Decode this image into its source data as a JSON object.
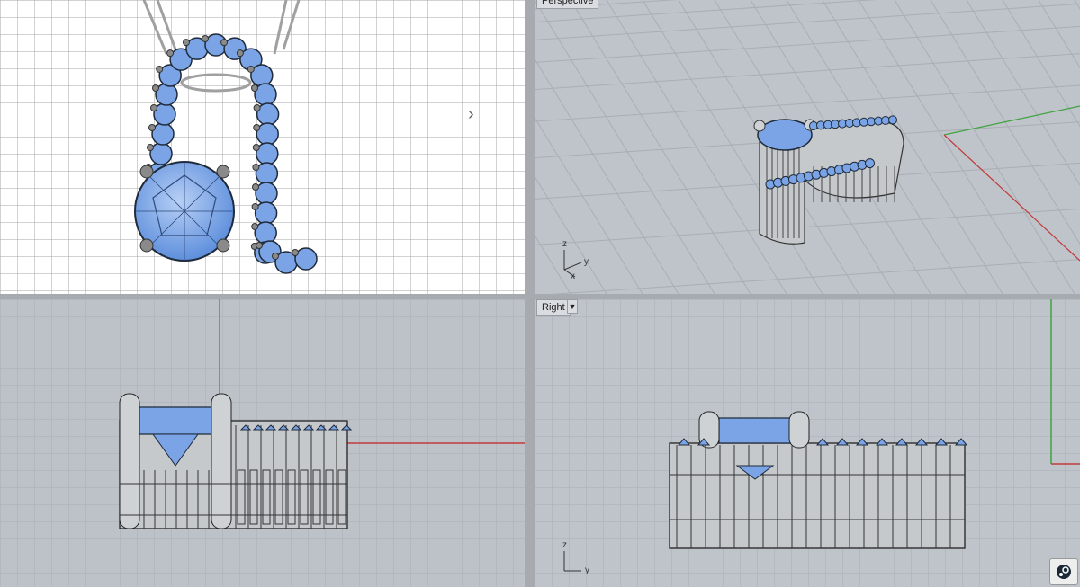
{
  "viewports": {
    "top": {
      "label": ""
    },
    "perspective": {
      "label": "Perspective"
    },
    "front": {
      "label": ""
    },
    "right": {
      "label": "Right",
      "menu_icon": "dropdown-arrow-icon"
    }
  },
  "axes": {
    "perspective": {
      "x": "x",
      "y": "y",
      "z": "z"
    },
    "right": {
      "y": "y",
      "z": "z"
    }
  },
  "icons": {
    "expand": "chevron-right-icon",
    "tray": "steam-icon"
  },
  "colors": {
    "gem": "#7aa4e6",
    "metal": "#c6c9cc",
    "grid_top": "#a6a6a6",
    "grid_gray": "#a9aeb4",
    "x_axis": "#c23b3b",
    "y_axis": "#3fa33f"
  }
}
